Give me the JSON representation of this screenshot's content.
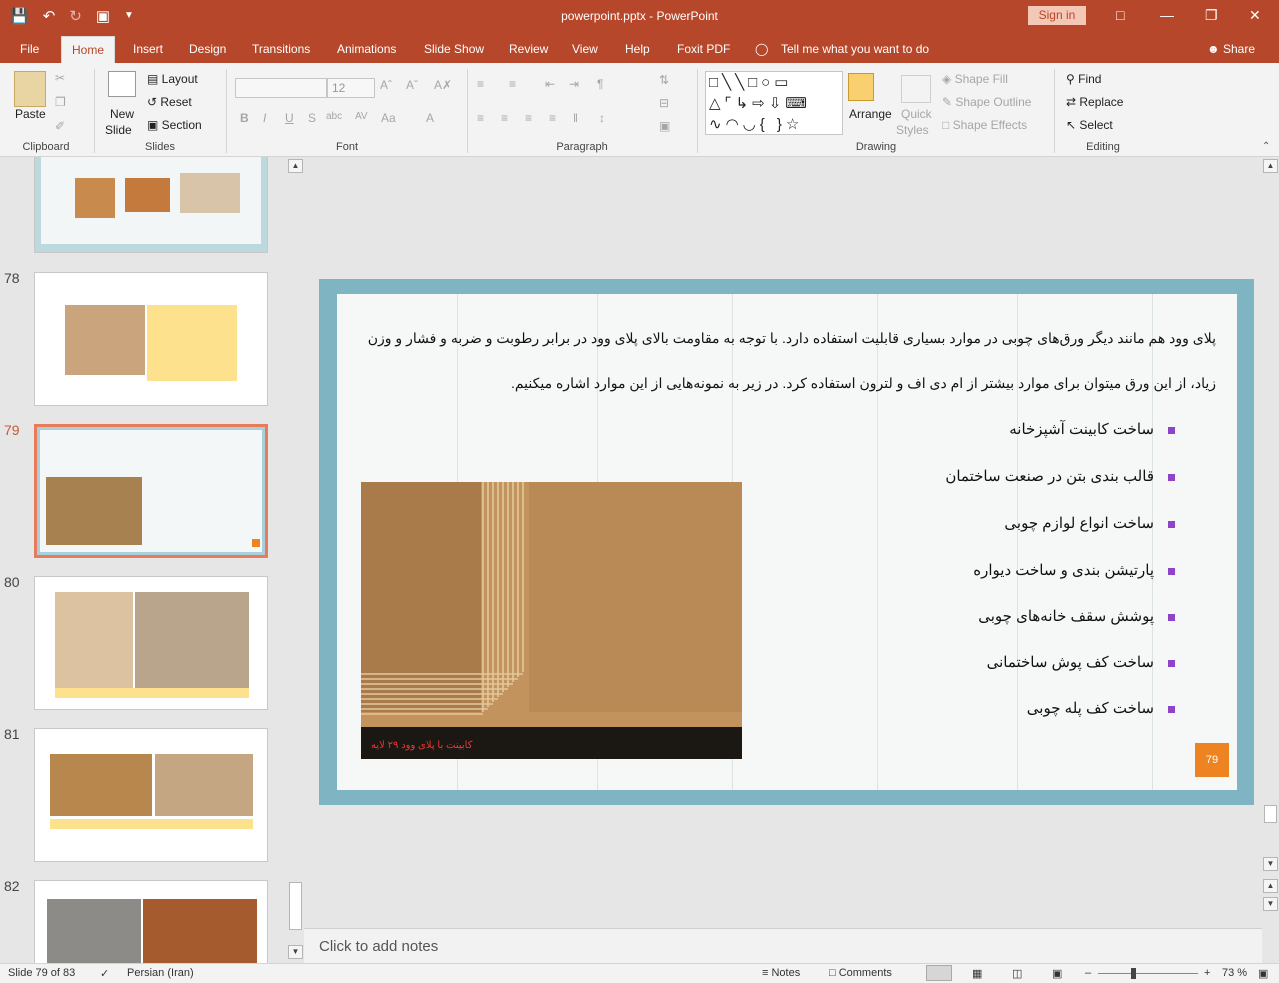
{
  "window": {
    "title": "powerpoint.pptx - PowerPoint",
    "signin": "Sign in"
  },
  "tabs": [
    "File",
    "Home",
    "Insert",
    "Design",
    "Transitions",
    "Animations",
    "Slide Show",
    "Review",
    "View",
    "Help",
    "Foxit PDF"
  ],
  "tellme": "Tell me what you want to do",
  "share": "Share",
  "ribbon": {
    "clipboard": {
      "paste": "Paste",
      "label": "Clipboard"
    },
    "slides": {
      "new_slide_1": "New",
      "new_slide_2": "Slide",
      "layout": "Layout",
      "reset": "Reset",
      "section": "Section",
      "label": "Slides"
    },
    "font": {
      "size": "12",
      "label": "Font"
    },
    "paragraph": {
      "label": "Paragraph"
    },
    "drawing": {
      "arrange": "Arrange",
      "quick_1": "Quick",
      "quick_2": "Styles",
      "fill": "Shape Fill",
      "outline": "Shape Outline",
      "effects": "Shape Effects",
      "label": "Drawing"
    },
    "editing": {
      "find": "Find",
      "replace": "Replace",
      "select": "Select",
      "label": "Editing"
    }
  },
  "thumbnails": [
    {
      "num": "78"
    },
    {
      "num": "79"
    },
    {
      "num": "80"
    },
    {
      "num": "81"
    },
    {
      "num": "82"
    }
  ],
  "slide": {
    "paragraph": "پلای وود هم مانند دیگر ورق‌های چوبی در موارد بسیاری قابلیت استفاده دارد. با توجه به مقاومت بالای پلای وود در برابر رطوبت و ضربه و فشار و وزن زیاد، از این ورق میتوان برای موارد بیشتر از ام دی اف و لترون استفاده کرد. در زیر به نمونه‌هایی از این موارد اشاره میکنیم.",
    "bullets": [
      "ساخت کابینت آشپزخانه",
      "قالب بندی بتن در صنعت ساختمان",
      "ساخت انواع لوازم چوبی",
      "پارتیشن بندی و ساخت دیواره",
      "پوشش سقف خانه‌های چوبی",
      "ساخت کف پوش ساختمانی",
      "ساخت کف پله چوبی"
    ],
    "caption": "کابینت با پلای وود ۲۹ لایه",
    "page_number": "79"
  },
  "notes_placeholder": "Click to add notes",
  "status": {
    "slide": "Slide 79 of 83",
    "language": "Persian (Iran)",
    "notes": "Notes",
    "comments": "Comments",
    "zoom": "73 %"
  },
  "colors": {
    "accent": "#b7472a",
    "slide_number_bg": "#ee8322",
    "bullet": "#8e44c9"
  }
}
